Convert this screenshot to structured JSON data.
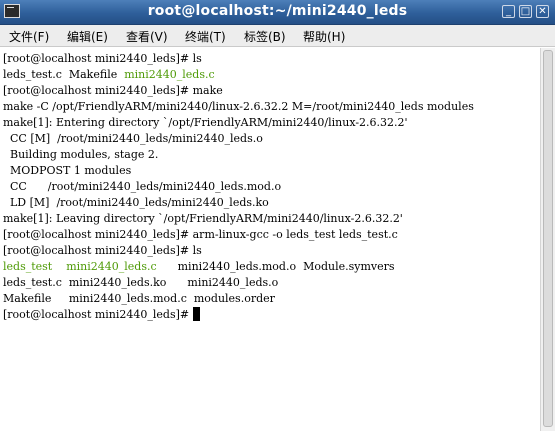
{
  "window": {
    "title": "root@localhost:~/mini2440_leds"
  },
  "window_buttons": {
    "minimize": "_",
    "maximize": "□",
    "close": "✕"
  },
  "menu": [
    {
      "label": "文件(F)"
    },
    {
      "label": "编辑(E)"
    },
    {
      "label": "查看(V)"
    },
    {
      "label": "终端(T)"
    },
    {
      "label": "标签(B)"
    },
    {
      "label": "帮助(H)"
    }
  ],
  "colors": {
    "executable": "#4e9a06",
    "titlebar": "#3a6ea5"
  },
  "terminal": {
    "lines": [
      {
        "segments": [
          {
            "text": "[root@localhost mini2440_leds]# ls"
          }
        ]
      },
      {
        "segments": [
          {
            "text": "leds_test.c  Makefile  "
          },
          {
            "text": "mini2440_leds.c",
            "color": "green"
          }
        ]
      },
      {
        "segments": [
          {
            "text": "[root@localhost mini2440_leds]# make"
          }
        ]
      },
      {
        "segments": [
          {
            "text": "make -C /opt/FriendlyARM/mini2440/linux-2.6.32.2 M=/root/mini2440_leds modules"
          }
        ]
      },
      {
        "segments": [
          {
            "text": "make[1]: Entering directory `/opt/FriendlyARM/mini2440/linux-2.6.32.2'"
          }
        ]
      },
      {
        "segments": [
          {
            "text": "  CC [M]  /root/mini2440_leds/mini2440_leds.o"
          }
        ]
      },
      {
        "segments": [
          {
            "text": "  Building modules, stage 2."
          }
        ]
      },
      {
        "segments": [
          {
            "text": "  MODPOST 1 modules"
          }
        ]
      },
      {
        "segments": [
          {
            "text": "  CC      /root/mini2440_leds/mini2440_leds.mod.o"
          }
        ]
      },
      {
        "segments": [
          {
            "text": "  LD [M]  /root/mini2440_leds/mini2440_leds.ko"
          }
        ]
      },
      {
        "segments": [
          {
            "text": "make[1]: Leaving directory `/opt/FriendlyARM/mini2440/linux-2.6.32.2'"
          }
        ]
      },
      {
        "segments": [
          {
            "text": "[root@localhost mini2440_leds]# arm-linux-gcc -o leds_test leds_test.c"
          }
        ]
      },
      {
        "segments": [
          {
            "text": "[root@localhost mini2440_leds]# ls"
          }
        ]
      },
      {
        "segments": [
          {
            "text": "leds_test",
            "color": "green"
          },
          {
            "text": "    "
          },
          {
            "text": "mini2440_leds.c",
            "color": "green"
          },
          {
            "text": "      mini2440_leds.mod.o  Module.symvers"
          }
        ]
      },
      {
        "segments": [
          {
            "text": "leds_test.c  mini2440_leds.ko      mini2440_leds.o"
          }
        ]
      },
      {
        "segments": [
          {
            "text": "Makefile     mini2440_leds.mod.c  modules.order"
          }
        ]
      },
      {
        "segments": [
          {
            "text": "[root@localhost mini2440_leds]# "
          }
        ],
        "cursor": true
      }
    ]
  }
}
